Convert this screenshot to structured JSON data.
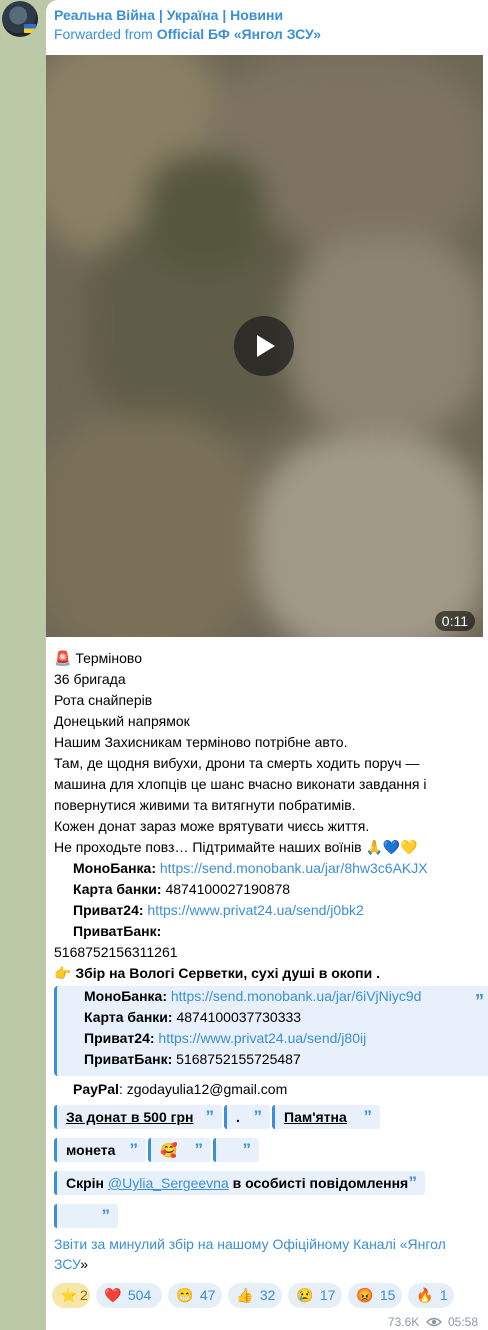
{
  "message": {
    "channel_name": "Реальна Війна | Україна | Новини",
    "forwarded_prefix": "Forwarded from",
    "forwarded_source": "Official БФ «Янгол ЗСУ»",
    "video_duration": "0:11",
    "lines": {
      "urgent": "Терміново",
      "brigade": "36 бригада",
      "unit": "Рота снайперів",
      "direction": "Донецький напрямок",
      "need": "Нашим Захисникам терміново потрібне авто.",
      "story1": "Там, де щодня вибухи, дрони та смерть ходить поруч —",
      "story2": "машина для хлопців це шанс вчасно виконати завдання і",
      "story3": "повернутися живими та витягнути побратимів.",
      "donate": "Кожен донат зараз може врятувати чиєсь життя.",
      "support": "Не проходьте повз… Підтримайте наших воїнів"
    },
    "bank1": {
      "mono_label": "МоноБанка:",
      "mono_link": "https://send.monobank.ua/jar/8hw3c6AKJX",
      "card_label": "Карта банки:",
      "card_number": "4874100027190878",
      "privat24_label": "Приват24:",
      "privat24_link": "https://www.privat24.ua/send/j0bk2",
      "privatbank_label": "ПриватБанк:",
      "privatbank_number": "5168752156311261"
    },
    "collection_title": "Збір на Вологі Серветки, сухі душі в окопи .",
    "quote_block": {
      "mono_label": "МоноБанка:",
      "mono_link": "https://send.monobank.ua/jar/6iVjNiyc9d",
      "card_label": "Карта банки:",
      "card_number": "4874100037730333",
      "privat24_label": "Приват24:",
      "privat24_link": "https://www.privat24.ua/send/j80ij",
      "privatbank_label": "ПриватБанк:",
      "privatbank_number": "5168752155725487"
    },
    "paypal_label": "PayPal",
    "paypal_value": ": zgodayulia12@gmail.com",
    "chips": {
      "donate500": "За донат в 500 грн",
      "dot": ".",
      "memorial": "Пам'ятна",
      "coin": "монета",
      "screen_prefix": "Скрін",
      "screen_mention": "@Uylia_Sergeevna",
      "screen_suffix": "в особисті повідомлення"
    },
    "reports_link": "Звіти за минулий збір на нашому Офіційному Каналі «Янгол ЗСУ",
    "reports_tail": "»",
    "reactions": [
      {
        "emoji": "⭐",
        "count": "2"
      },
      {
        "emoji": "❤️",
        "count": "504"
      },
      {
        "emoji": "😁",
        "count": "47"
      },
      {
        "emoji": "👍",
        "count": "32"
      },
      {
        "emoji": "😢",
        "count": "17"
      },
      {
        "emoji": "😡",
        "count": "15"
      },
      {
        "emoji": "🔥",
        "count": "1"
      }
    ],
    "views": "73.6K",
    "time": "05:58"
  }
}
